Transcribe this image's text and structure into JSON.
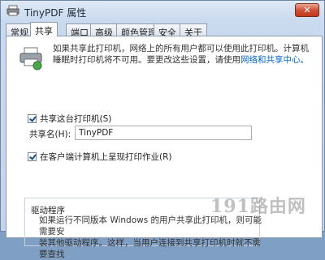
{
  "window": {
    "title": "TinyPDF 属性",
    "close_label": "✕"
  },
  "tabs": [
    {
      "label": "常规"
    },
    {
      "label": "共享"
    },
    {
      "label": "端口"
    },
    {
      "label": "高级"
    },
    {
      "label": "颜色管理"
    },
    {
      "label": "安全"
    },
    {
      "label": "关于"
    }
  ],
  "sharing": {
    "description_line1": "如果共享此打印机，网络上的所有用户都可以使用此打印机。计算机",
    "description_line2_prefix": "睡眠时打印机将不可用。要更改这些设置，请使用",
    "network_link": "网络和共享中心。",
    "share_checkbox_label": "共享这台打印机(S)",
    "share_name_label": "共享名(H):",
    "share_name_value": "TinyPDF",
    "render_checkbox_label": "在客户端计算机上呈现打印作业(R)"
  },
  "drivers": {
    "title": "驱动程序",
    "text_line1": "如果运行不同版本 Windows 的用户共享此打印机，则可能需要安",
    "text_line2": "装其他驱动程序。这样，当用户连接到共享打印机时就不需要查找"
  },
  "watermark": "191路由网"
}
